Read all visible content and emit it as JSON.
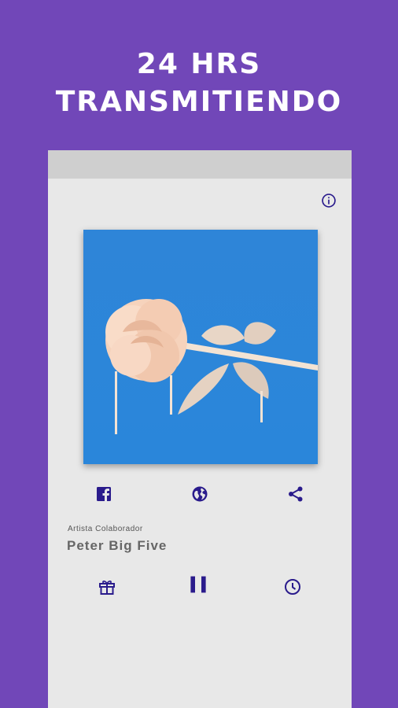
{
  "headline": {
    "line1": "24 HRS",
    "line2": "TRANSMITIENDO"
  },
  "colors": {
    "background": "#7147B8",
    "accent": "#2A1B8C",
    "panel": "#E8E8E8"
  },
  "icons": {
    "info": "info-icon",
    "album": "rose-album-art",
    "facebook": "facebook-icon",
    "web": "globe-icon",
    "share": "share-icon",
    "gift": "gift-icon",
    "pause": "pause-icon",
    "timer": "clock-icon"
  },
  "track": {
    "artist_label": "Artista Colaborador",
    "artist_name": "Peter Big Five"
  }
}
